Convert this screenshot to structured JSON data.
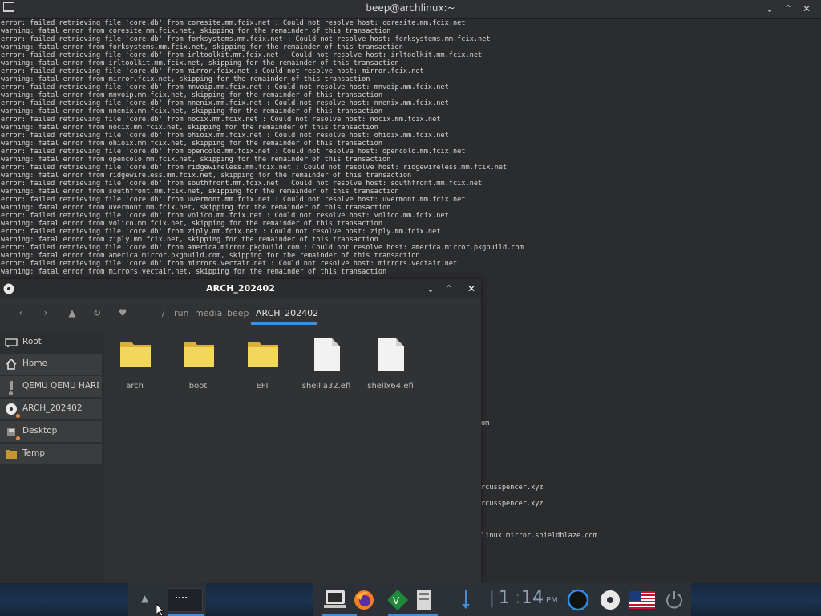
{
  "terminal": {
    "title": "beep@archlinux:~",
    "lines": [
      "error: failed retrieving file 'core.db' from coresite.mm.fcix.net : Could not resolve host: coresite.mm.fcix.net",
      "warning: fatal error from coresite.mm.fcix.net, skipping for the remainder of this transaction",
      "error: failed retrieving file 'core.db' from forksystems.mm.fcix.net : Could not resolve host: forksystems.mm.fcix.net",
      "warning: fatal error from forksystems.mm.fcix.net, skipping for the remainder of this transaction",
      "error: failed retrieving file 'core.db' from irltoolkit.mm.fcix.net : Could not resolve host: irltoolkit.mm.fcix.net",
      "warning: fatal error from irltoolkit.mm.fcix.net, skipping for the remainder of this transaction",
      "error: failed retrieving file 'core.db' from mirror.fcix.net : Could not resolve host: mirror.fcix.net",
      "warning: fatal error from mirror.fcix.net, skipping for the remainder of this transaction",
      "error: failed retrieving file 'core.db' from mnvoip.mm.fcix.net : Could not resolve host: mnvoip.mm.fcix.net",
      "warning: fatal error from mnvoip.mm.fcix.net, skipping for the remainder of this transaction",
      "error: failed retrieving file 'core.db' from nnenix.mm.fcix.net : Could not resolve host: nnenix.mm.fcix.net",
      "warning: fatal error from nnenix.mm.fcix.net, skipping for the remainder of this transaction",
      "error: failed retrieving file 'core.db' from nocix.mm.fcix.net : Could not resolve host: nocix.mm.fcix.net",
      "warning: fatal error from nocix.mm.fcix.net, skipping for the remainder of this transaction",
      "error: failed retrieving file 'core.db' from ohioix.mm.fcix.net : Could not resolve host: ohioix.mm.fcix.net",
      "warning: fatal error from ohioix.mm.fcix.net, skipping for the remainder of this transaction",
      "error: failed retrieving file 'core.db' from opencolo.mm.fcix.net : Could not resolve host: opencolo.mm.fcix.net",
      "warning: fatal error from opencolo.mm.fcix.net, skipping for the remainder of this transaction",
      "error: failed retrieving file 'core.db' from ridgewireless.mm.fcix.net : Could not resolve host: ridgewireless.mm.fcix.net",
      "warning: fatal error from ridgewireless.mm.fcix.net, skipping for the remainder of this transaction",
      "error: failed retrieving file 'core.db' from southfront.mm.fcix.net : Could not resolve host: southfront.mm.fcix.net",
      "warning: fatal error from southfront.mm.fcix.net, skipping for the remainder of this transaction",
      "error: failed retrieving file 'core.db' from uvermont.mm.fcix.net : Could not resolve host: uvermont.mm.fcix.net",
      "warning: fatal error from uvermont.mm.fcix.net, skipping for the remainder of this transaction",
      "error: failed retrieving file 'core.db' from volico.mm.fcix.net : Could not resolve host: volico.mm.fcix.net",
      "warning: fatal error from volico.mm.fcix.net, skipping for the remainder of this transaction",
      "error: failed retrieving file 'core.db' from ziply.mm.fcix.net : Could not resolve host: ziply.mm.fcix.net",
      "warning: fatal error from ziply.mm.fcix.net, skipping for the remainder of this transaction",
      "error: failed retrieving file 'core.db' from america.mirror.pkgbuild.com : Could not resolve host: america.mirror.pkgbuild.com",
      "warning: fatal error from america.mirror.pkgbuild.com, skipping for the remainder of this transaction",
      "error: failed retrieving file 'core.db' from mirrors.vectair.net : Could not resolve host: mirrors.vectair.net",
      "warning: fatal error from mirrors.vectair.net, skipping for the remainder of this transaction"
    ],
    "fragments": [
      "om",
      "rcusspencer.xyz",
      "rcusspencer.xyz",
      "linux.mirror.shieldblaze.com"
    ]
  },
  "file_manager": {
    "title": "ARCH_202402",
    "breadcrumbs": [
      "/",
      "run",
      "media",
      "beep",
      "ARCH_202402"
    ],
    "sidebar": [
      {
        "label": "Root",
        "icon": "drive-icon"
      },
      {
        "label": "Home",
        "icon": "home-icon"
      },
      {
        "label": "QEMU QEMU HARDDISK",
        "icon": "usb-drive-icon"
      },
      {
        "label": "ARCH_202402",
        "icon": "optical-disc-icon"
      },
      {
        "label": "Desktop",
        "icon": "desktop-icon"
      },
      {
        "label": "Temp",
        "icon": "folder-icon"
      }
    ],
    "files": [
      {
        "name": "arch",
        "type": "folder"
      },
      {
        "name": "boot",
        "type": "folder"
      },
      {
        "name": "EFI",
        "type": "folder"
      },
      {
        "name": "shellia32.efi",
        "type": "file"
      },
      {
        "name": "shellx64.efi",
        "type": "file"
      }
    ]
  },
  "taskbar": {
    "clock": [
      "1",
      "1",
      "4",
      "PM"
    ],
    "accent": "#3d8ee0"
  }
}
